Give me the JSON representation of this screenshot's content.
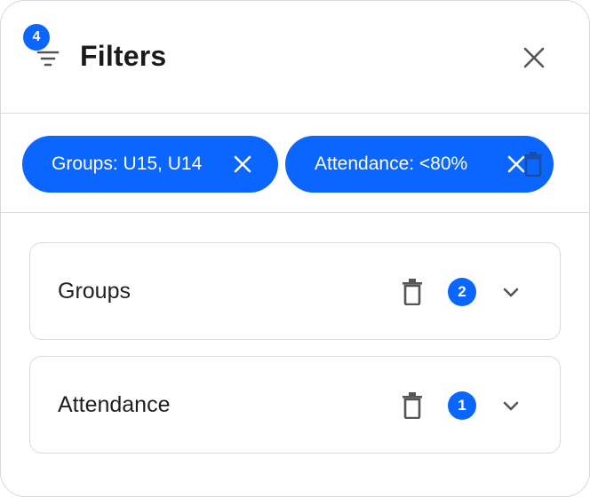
{
  "header": {
    "title": "Filters",
    "active_count": "4",
    "icons": {
      "filter": "filter-lines-icon",
      "close": "close-icon"
    }
  },
  "chips": [
    {
      "label": "Groups: U15, U14",
      "remove_icon": "close-icon"
    },
    {
      "label": "Attendance: <80%",
      "remove_icon": "close-icon"
    }
  ],
  "sections": [
    {
      "label": "Groups",
      "count": "2",
      "icons": [
        "trash-icon",
        "chevron-down-icon"
      ]
    },
    {
      "label": "Attendance",
      "count": "1",
      "icons": [
        "trash-icon",
        "chevron-down-icon"
      ]
    }
  ],
  "colors": {
    "accent": "#0a66ff",
    "border": "#dadada",
    "text": "#1f1f1f",
    "icon": "#555555"
  }
}
